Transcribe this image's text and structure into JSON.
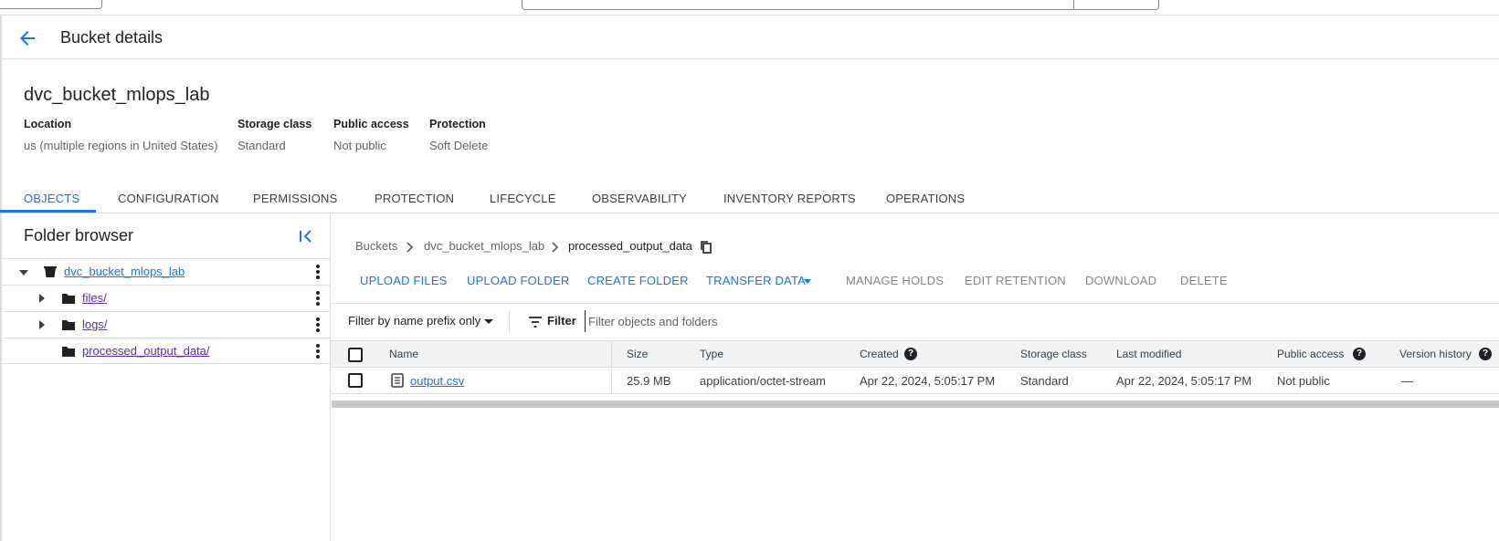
{
  "header": {
    "title": "Bucket details"
  },
  "bucket": {
    "name": "dvc_bucket_mlops_lab",
    "meta": [
      {
        "label": "Location",
        "value": "us (multiple regions in United States)"
      },
      {
        "label": "Storage class",
        "value": "Standard"
      },
      {
        "label": "Public access",
        "value": "Not public"
      },
      {
        "label": "Protection",
        "value": "Soft Delete"
      }
    ]
  },
  "tabs": [
    {
      "label": "OBJECTS",
      "active": true
    },
    {
      "label": "CONFIGURATION"
    },
    {
      "label": "PERMISSIONS"
    },
    {
      "label": "PROTECTION"
    },
    {
      "label": "LIFECYCLE"
    },
    {
      "label": "OBSERVABILITY"
    },
    {
      "label": "INVENTORY REPORTS"
    },
    {
      "label": "OPERATIONS"
    }
  ],
  "folder_browser": {
    "title": "Folder browser",
    "items": [
      {
        "label": "dvc_bucket_mlops_lab",
        "icon": "bucket-icon",
        "expanded": true
      },
      {
        "label": "files/",
        "icon": "folder-icon",
        "expanded": false
      },
      {
        "label": "logs/",
        "icon": "folder-icon",
        "expanded": false
      },
      {
        "label": "processed_output_data/",
        "icon": "folder-icon"
      }
    ]
  },
  "breadcrumb": [
    "Buckets",
    "dvc_bucket_mlops_lab",
    "processed_output_data"
  ],
  "actions": [
    {
      "label": "UPLOAD FILES",
      "enabled": true
    },
    {
      "label": "UPLOAD FOLDER",
      "enabled": true
    },
    {
      "label": "CREATE FOLDER",
      "enabled": true
    },
    {
      "label": "TRANSFER DATA",
      "enabled": true
    },
    {
      "label": "MANAGE HOLDS",
      "enabled": false
    },
    {
      "label": "EDIT RETENTION",
      "enabled": false
    },
    {
      "label": "DOWNLOAD",
      "enabled": false
    },
    {
      "label": "DELETE",
      "enabled": false
    }
  ],
  "filter": {
    "mode": "Filter by name prefix only",
    "label": "Filter",
    "placeholder": "Filter objects and folders"
  },
  "table": {
    "columns": [
      "Name",
      "Size",
      "Type",
      "Created",
      "Storage class",
      "Last modified",
      "Public access",
      "Version history"
    ],
    "rows": [
      {
        "name": "output.csv",
        "size": "25.9 MB",
        "type": "application/octet-stream",
        "created": "Apr 22, 2024, 5:05:17 PM",
        "storage_class": "Standard",
        "last_modified": "Apr 22, 2024, 5:05:17 PM",
        "public_access": "Not public",
        "version_history": "—"
      }
    ]
  },
  "colors": {
    "accent": "#1a73e8",
    "visited_link": "#5b2ea6",
    "border": "#dadce0",
    "header_bg": "#f1f3f4"
  }
}
